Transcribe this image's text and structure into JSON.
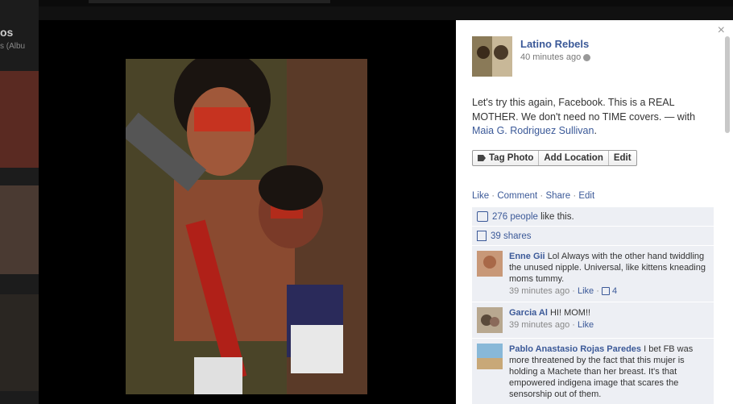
{
  "background": {
    "title": "os",
    "subtitle": "s (Albu"
  },
  "post": {
    "author": "Latino Rebels",
    "time": "40 minutes ago",
    "caption": "Let's try this again, Facebook. This is a REAL MOTHER. We don't need no TIME covers. — with ",
    "tagged": "Maia G. Rodriguez Sullivan",
    "caption_end": "."
  },
  "photo_actions": [
    "Tag Photo",
    "Add Location",
    "Edit"
  ],
  "links": [
    "Like",
    "Comment",
    "Share",
    "Edit"
  ],
  "likes": {
    "count_text": "276 people",
    "suffix": " like this."
  },
  "shares": {
    "text": "39 shares"
  },
  "comments": [
    {
      "name": "Enne Gii",
      "text": "Lol Always with the other hand twiddling the unused nipple. Universal, like kittens kneading moms tummy.",
      "time": "39 minutes ago",
      "like": "Like",
      "likes": "4"
    },
    {
      "name": "Garcia Al",
      "text": "HI! MOM!!",
      "time": "39 minutes ago",
      "like": "Like",
      "likes": ""
    },
    {
      "name": "Pablo Anastasio Rojas Paredes",
      "text": "I bet FB was more threatened by the fact that this mujer is holding a Machete than her breast. It's that empowered indigena image that scares the sensorship out of them.",
      "time": "",
      "like": "",
      "likes": ""
    }
  ],
  "icons": {
    "close": "×"
  },
  "colors": {
    "link": "#3b5998",
    "panel": "#edeff4"
  }
}
